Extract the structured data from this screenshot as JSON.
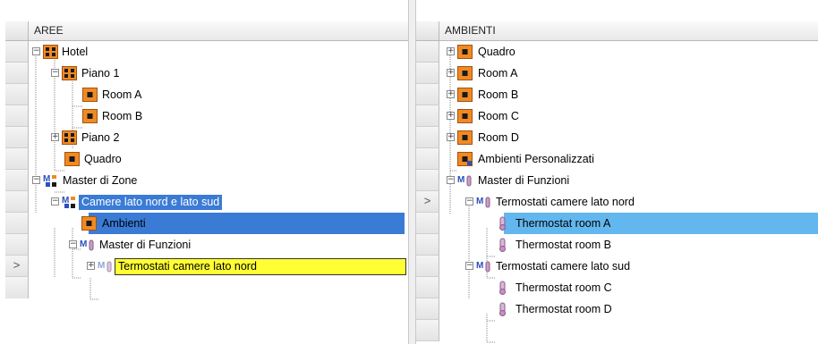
{
  "left_panel": {
    "header": "AREE",
    "nodes": [
      {
        "label": "Hotel",
        "icon": "grid-building-icon",
        "expander": "−"
      },
      {
        "label": "Piano 1",
        "icon": "grid-building-icon",
        "expander": "−"
      },
      {
        "label": "Room A",
        "icon": "room-icon"
      },
      {
        "label": "Room B",
        "icon": "room-icon"
      },
      {
        "label": "Piano 2",
        "icon": "grid-building-icon",
        "expander": "+"
      },
      {
        "label": "Quadro",
        "icon": "room-icon"
      },
      {
        "label": "Master di Zone",
        "icon": "master-zone-icon",
        "expander": "−"
      },
      {
        "label": "Camere lato nord e lato sud",
        "icon": "master-zone-icon",
        "expander": "−",
        "state": "selected"
      },
      {
        "label": "Ambienti",
        "icon": "room-icon"
      },
      {
        "label": "Master di Funzioni",
        "icon": "master-function-icon",
        "expander": "−"
      },
      {
        "label": "Termostati camere lato nord",
        "icon": "thermostat-group-icon",
        "expander": "+",
        "state": "editing"
      }
    ],
    "row_pointer": ">"
  },
  "right_panel": {
    "header": "AMBIENTI",
    "nodes": [
      {
        "label": "Quadro",
        "icon": "room-icon",
        "expander": "+"
      },
      {
        "label": "Room A",
        "icon": "room-icon",
        "expander": "+"
      },
      {
        "label": "Room B",
        "icon": "room-icon",
        "expander": "+"
      },
      {
        "label": "Room C",
        "icon": "room-icon",
        "expander": "+"
      },
      {
        "label": "Room D",
        "icon": "room-icon",
        "expander": "+"
      },
      {
        "label": "Ambienti Personalizzati",
        "icon": "custom-room-icon"
      },
      {
        "label": "Master di Funzioni",
        "icon": "master-function-icon",
        "expander": "−"
      },
      {
        "label": "Termostati camere lato nord",
        "icon": "master-function-icon",
        "expander": "−",
        "state": "selected"
      },
      {
        "label": "Thermostat room A",
        "icon": "thermometer-icon"
      },
      {
        "label": "Thermostat room B",
        "icon": "thermometer-icon"
      },
      {
        "label": "Termostati camere lato sud",
        "icon": "master-function-icon",
        "expander": "−"
      },
      {
        "label": "Thermostat room C",
        "icon": "thermometer-icon"
      },
      {
        "label": "Thermostat room D",
        "icon": "thermometer-icon"
      }
    ],
    "row_pointer": ">"
  },
  "colors": {
    "selection_blue": "#3a7bd5",
    "selection_light_blue": "#62b7ee",
    "editing_yellow": "#ffff33",
    "icon_orange": "#f08a24"
  }
}
